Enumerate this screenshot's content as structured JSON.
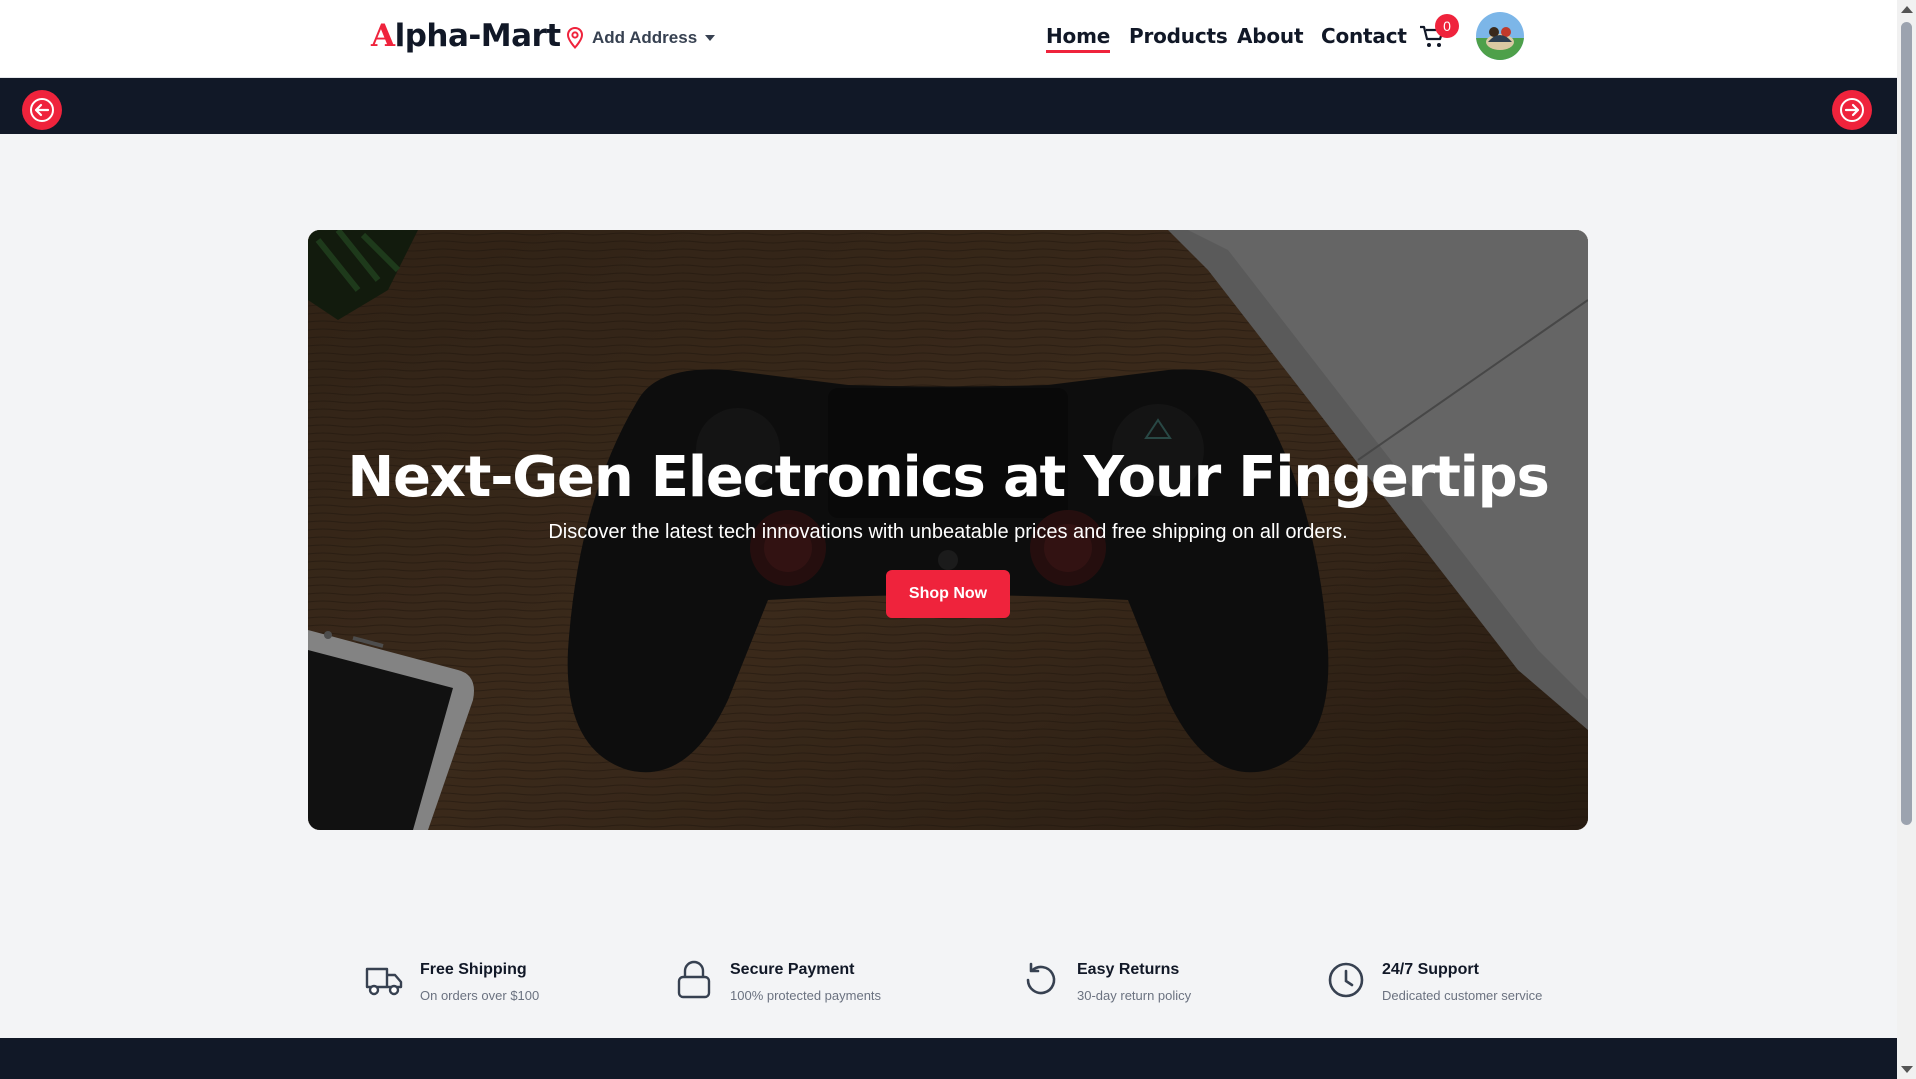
{
  "header": {
    "logo_first": "A",
    "logo_rest": "lpha-Mart",
    "address_label": "Add Address",
    "nav": [
      "Home",
      "Products",
      "About",
      "Contact"
    ],
    "active_nav": "Home",
    "cart_count": "0"
  },
  "hero": {
    "title": "Next-Gen Electronics at Your Fingertips",
    "subtitle": "Discover the latest tech innovations with unbeatable prices and free shipping on all orders.",
    "cta": "Shop Now"
  },
  "features": [
    {
      "title": "Free Shipping",
      "subtitle": "On orders over $100",
      "icon": "truck-icon"
    },
    {
      "title": "Secure Payment",
      "subtitle": "100% protected payments",
      "icon": "lock-icon"
    },
    {
      "title": "Easy Returns",
      "subtitle": "30-day return policy",
      "icon": "rotate-ccw-icon"
    },
    {
      "title": "24/7 Support",
      "subtitle": "Dedicated customer service",
      "icon": "clock-icon"
    }
  ],
  "colors": {
    "accent": "#ef233c",
    "dark": "#111827",
    "background": "#f3f4f6"
  }
}
